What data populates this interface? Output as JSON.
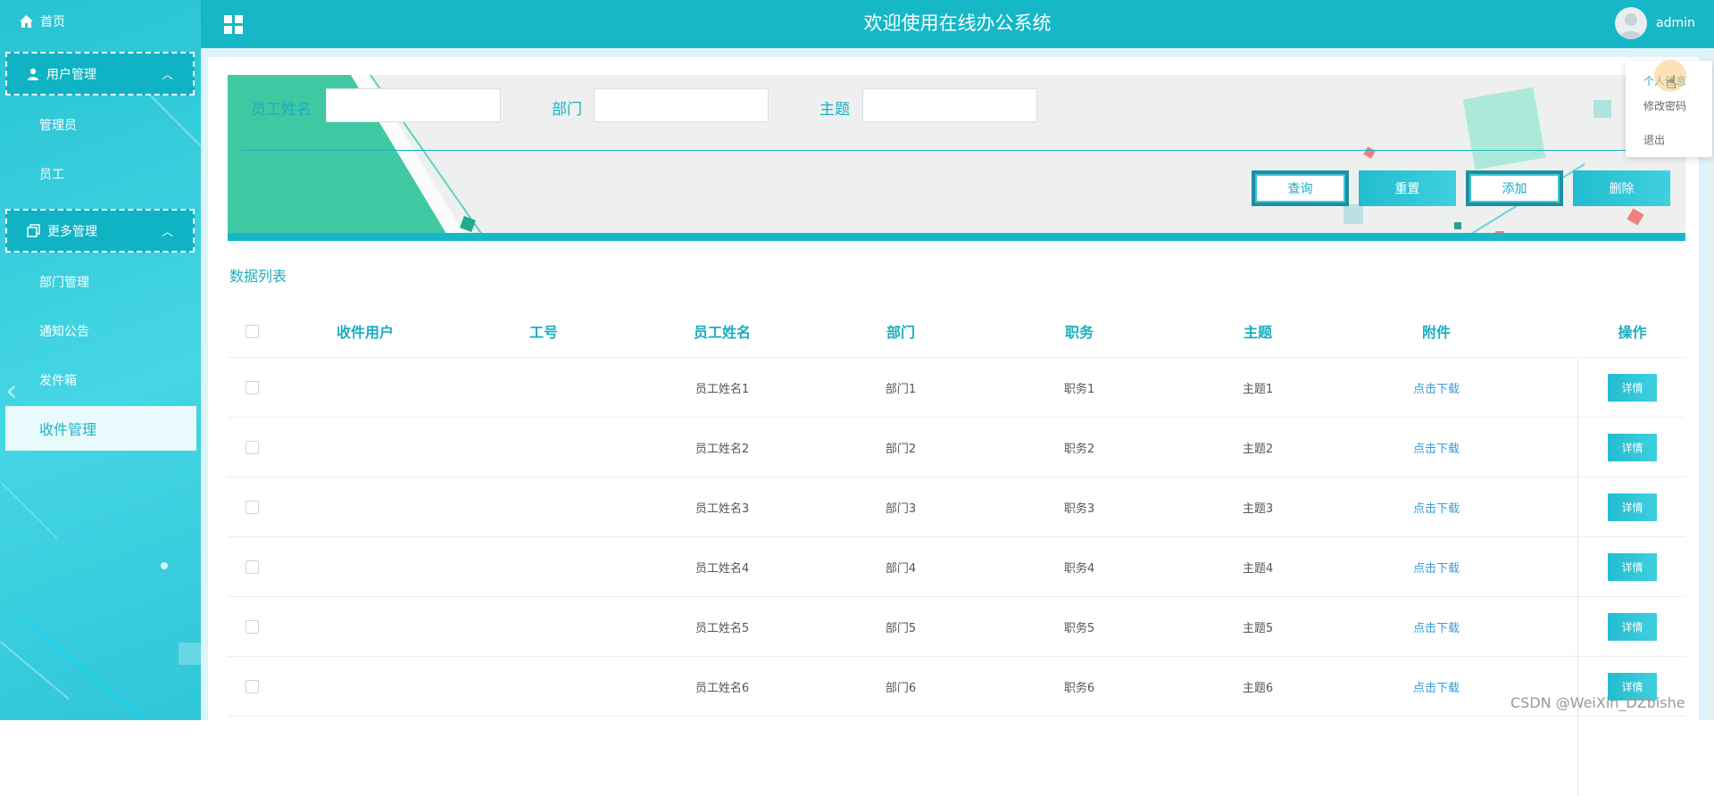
{
  "sidebar": {
    "home": "首页",
    "groups": [
      {
        "label": "用户管理",
        "items": [
          "管理员",
          "员工"
        ]
      },
      {
        "label": "更多管理",
        "items": [
          "部门管理",
          "通知公告",
          "发件箱"
        ]
      }
    ],
    "active_item": "收件管理"
  },
  "header": {
    "title": "欢迎使用在线办公系统",
    "user": "admin"
  },
  "user_menu": [
    "个人信息",
    "修改密码",
    "退出"
  ],
  "search": {
    "fields": [
      {
        "label": "员工姓名",
        "value": ""
      },
      {
        "label": "部门",
        "value": ""
      },
      {
        "label": "主题",
        "value": ""
      }
    ],
    "buttons": {
      "query": "查询",
      "reset": "重置",
      "add": "添加",
      "delete": "删除"
    }
  },
  "list": {
    "title": "数据列表",
    "columns": [
      "收件用户",
      "工号",
      "员工姓名",
      "部门",
      "职务",
      "主题",
      "附件",
      "操作"
    ],
    "rows": [
      {
        "recipient": "",
        "emp_no": "",
        "name": "员工姓名1",
        "dept": "部门1",
        "position": "职务1",
        "subject": "主题1",
        "attachment": "点击下载",
        "action": "详情"
      },
      {
        "recipient": "",
        "emp_no": "",
        "name": "员工姓名2",
        "dept": "部门2",
        "position": "职务2",
        "subject": "主题2",
        "attachment": "点击下载",
        "action": "详情"
      },
      {
        "recipient": "",
        "emp_no": "",
        "name": "员工姓名3",
        "dept": "部门3",
        "position": "职务3",
        "subject": "主题3",
        "attachment": "点击下载",
        "action": "详情"
      },
      {
        "recipient": "",
        "emp_no": "",
        "name": "员工姓名4",
        "dept": "部门4",
        "position": "职务4",
        "subject": "主题4",
        "attachment": "点击下载",
        "action": "详情"
      },
      {
        "recipient": "",
        "emp_no": "",
        "name": "员工姓名5",
        "dept": "部门5",
        "position": "职务5",
        "subject": "主题5",
        "attachment": "点击下载",
        "action": "详情"
      },
      {
        "recipient": "",
        "emp_no": "",
        "name": "员工姓名6",
        "dept": "部门6",
        "position": "职务6",
        "subject": "主题6",
        "attachment": "点击下载",
        "action": "详情"
      }
    ]
  },
  "watermark": "CSDN @WeiXin_DZbishe",
  "colors": {
    "primary": "#16b7c7",
    "accent_text": "#1aaec0",
    "link": "#3a9bd8"
  },
  "icons": {
    "home": "home-icon",
    "user": "user-icon",
    "copy": "copy-icon",
    "grid": "grid-icon",
    "chevron": "chevron-up-icon"
  }
}
